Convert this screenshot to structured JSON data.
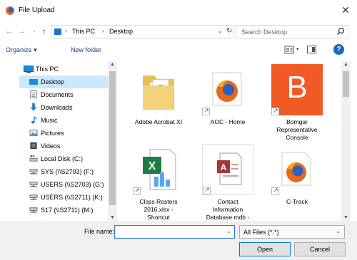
{
  "window": {
    "title": "File Upload",
    "close_glyph": "✕"
  },
  "nav": {
    "back_glyph": "←",
    "forward_glyph": "→",
    "recent_glyph": "⌄",
    "up_glyph": "↑",
    "chevron": "›",
    "path": [
      "This PC",
      "Desktop"
    ],
    "dropdown_glyph": "⌄",
    "refresh_glyph": "↻"
  },
  "search": {
    "placeholder": "Search Desktop"
  },
  "toolbar": {
    "organize": "Organize ▾",
    "new_folder": "New folder",
    "view_dd": "▾",
    "help": "?"
  },
  "sidebar": {
    "items": [
      {
        "label": "This PC",
        "icon": "pc-icon"
      },
      {
        "label": "Desktop",
        "icon": "desktop-icon",
        "selected": true
      },
      {
        "label": "Documents",
        "icon": "documents-icon"
      },
      {
        "label": "Downloads",
        "icon": "downloads-icon"
      },
      {
        "label": "Music",
        "icon": "music-icon"
      },
      {
        "label": "Pictures",
        "icon": "pictures-icon"
      },
      {
        "label": "Videos",
        "icon": "videos-icon"
      },
      {
        "label": "Local Disk (C:)",
        "icon": "disk-icon"
      },
      {
        "label": "SYS (\\\\S2703) (F:)",
        "icon": "network-drive-icon"
      },
      {
        "label": "USERS (\\\\S2703) (G:)",
        "icon": "network-drive-icon"
      },
      {
        "label": "USERS (\\\\S2711) (K:)",
        "icon": "network-drive-icon"
      },
      {
        "label": "S17 (\\\\S2711) (M:)",
        "icon": "network-drive-icon"
      }
    ]
  },
  "files": [
    {
      "label": "Adobe Acrobat XI",
      "icon": "folder-icon"
    },
    {
      "label": "AOC - Home",
      "icon": "firefox-icon"
    },
    {
      "label": "Bomgar\nRepresentative\nConsole",
      "icon": "bomgar-icon",
      "letter": "B"
    },
    {
      "label": "Class Rosters\n2016.xlsx -\nShortcut",
      "icon": "excel-icon"
    },
    {
      "label": "Contact\nInformation\nDatabase.mdb -",
      "icon": "access-icon"
    },
    {
      "label": "C-Track",
      "icon": "firefox-icon"
    }
  ],
  "footer": {
    "filename_label": "File name:",
    "filename_value": "",
    "filetype_value": "All Files (*.*)",
    "dd_glyph": "⌄",
    "open_label": "Open",
    "cancel_label": "Cancel"
  },
  "colors": {
    "accent": "#0078d7",
    "selection": "#cce8ff",
    "bomgar": "#f15a24"
  }
}
